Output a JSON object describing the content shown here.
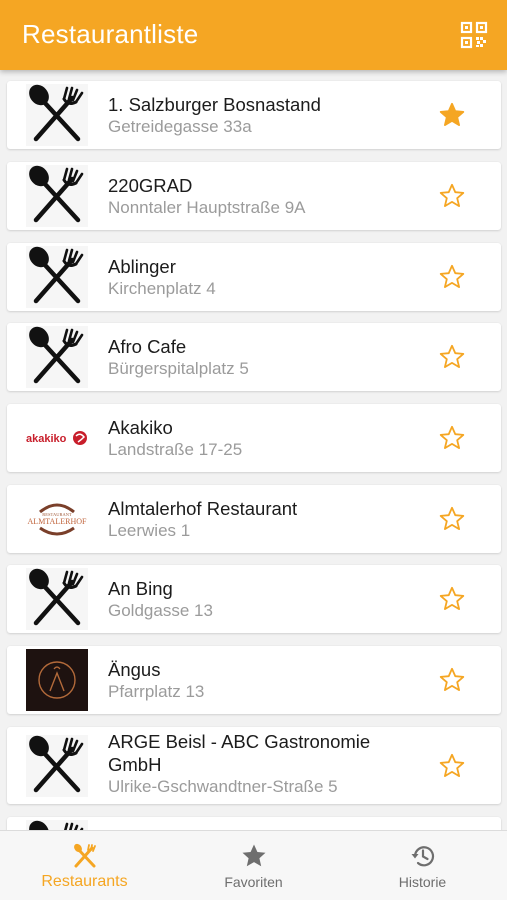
{
  "header": {
    "title": "Restaurantliste",
    "qr_icon": "qr-scan-icon"
  },
  "colors": {
    "accent": "#f5a623",
    "title_text": "#1c1c1c",
    "subtitle_text": "#9b9b9b"
  },
  "restaurants": [
    {
      "name": "1. Salzburger Bosnastand",
      "address": "Getreidegasse 33a",
      "favorite": true,
      "logo": "cutlery-icon"
    },
    {
      "name": "220GRAD",
      "address": "Nonntaler Hauptstraße 9A",
      "favorite": false,
      "logo": "cutlery-icon"
    },
    {
      "name": "Ablinger",
      "address": "Kirchenplatz 4",
      "favorite": false,
      "logo": "cutlery-icon"
    },
    {
      "name": "Afro Cafe",
      "address": "Bürgerspitalplatz 5",
      "favorite": false,
      "logo": "cutlery-icon"
    },
    {
      "name": "Akakiko",
      "address": "Landstraße 17-25",
      "favorite": false,
      "logo": "akakiko-logo",
      "logo_text": "akakiko"
    },
    {
      "name": "Almtalerhof Restaurant",
      "address": "Leerwies 1",
      "favorite": false,
      "logo": "almtalerhof-logo",
      "logo_text": "ALMTALERHOF"
    },
    {
      "name": "An Bing",
      "address": "Goldgasse 13",
      "favorite": false,
      "logo": "cutlery-icon"
    },
    {
      "name": "Ängus",
      "address": "Pfarrplatz 13",
      "favorite": false,
      "logo": "angus-logo"
    },
    {
      "name": "ARGE Beisl - ABC Gastronomie GmbH",
      "address": "Ulrike-Gschwandtner-Straße 5",
      "favorite": false,
      "logo": "cutlery-icon"
    }
  ],
  "bottom_nav": [
    {
      "label": "Restaurants",
      "icon": "restaurant-icon",
      "active": true
    },
    {
      "label": "Favoriten",
      "icon": "star-icon",
      "active": false
    },
    {
      "label": "Historie",
      "icon": "history-icon",
      "active": false
    }
  ]
}
